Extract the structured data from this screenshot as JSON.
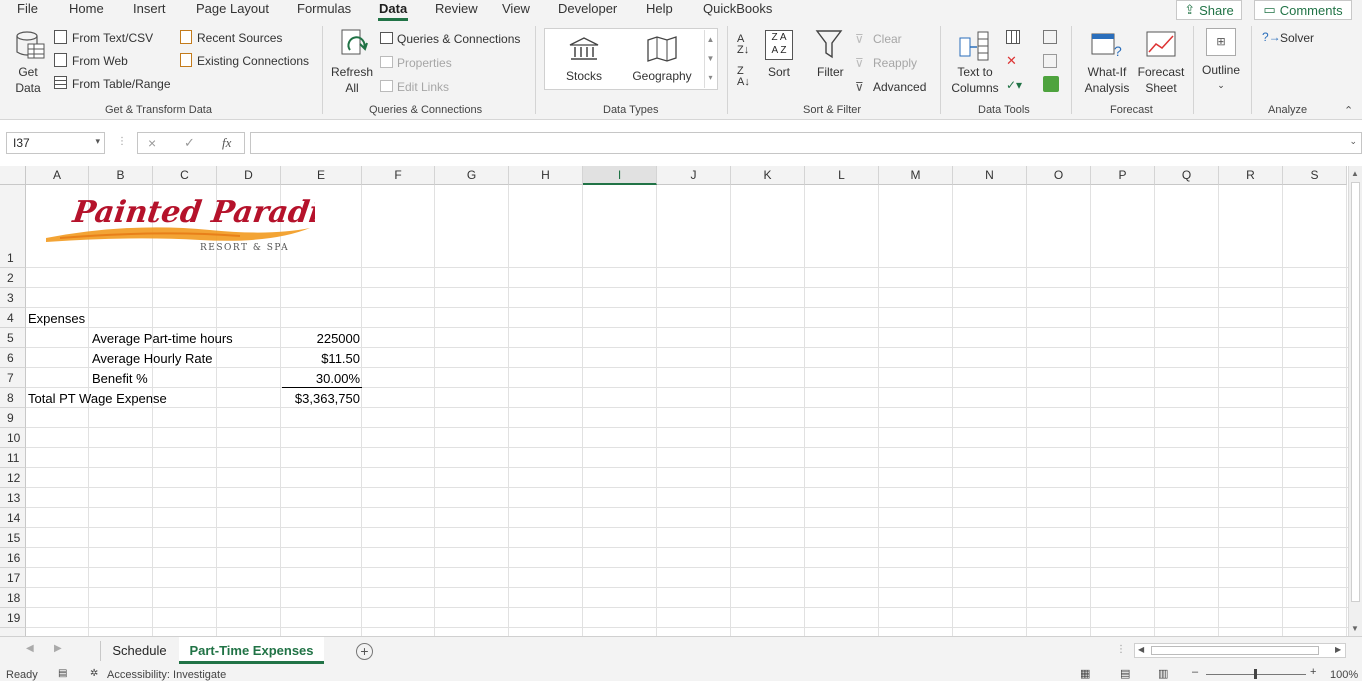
{
  "menu": {
    "tabs": [
      "File",
      "Home",
      "Insert",
      "Page Layout",
      "Formulas",
      "Data",
      "Review",
      "View",
      "Developer",
      "Help",
      "QuickBooks"
    ],
    "share": "Share",
    "comments": "Comments"
  },
  "ribbon": {
    "get_data": {
      "line1": "Get",
      "line2": "Data"
    },
    "from_text_csv": "From Text/CSV",
    "from_web": "From Web",
    "from_table_range": "From Table/Range",
    "recent_sources": "Recent Sources",
    "existing_connections": "Existing Connections",
    "group_get_transform": "Get & Transform Data",
    "refresh": {
      "line1": "Refresh",
      "line2": "All"
    },
    "queries_connections": "Queries & Connections",
    "properties": "Properties",
    "edit_links": "Edit Links",
    "group_queries": "Queries & Connections",
    "stocks": "Stocks",
    "geography": "Geography",
    "group_data_types": "Data Types",
    "sort": "Sort",
    "filter": "Filter",
    "clear": "Clear",
    "reapply": "Reapply",
    "advanced": "Advanced",
    "group_sort_filter": "Sort & Filter",
    "text_to_columns": {
      "line1": "Text to",
      "line2": "Columns"
    },
    "group_data_tools": "Data Tools",
    "what_if": {
      "line1": "What-If",
      "line2": "Analysis"
    },
    "forecast_sheet": {
      "line1": "Forecast",
      "line2": "Sheet"
    },
    "group_forecast": "Forecast",
    "outline": "Outline",
    "solver": "Solver",
    "group_analyze": "Analyze"
  },
  "formula_bar": {
    "name_box": "I37",
    "cancel": "×",
    "enter": "✓",
    "fx": "fx",
    "formula": ""
  },
  "grid": {
    "columns": [
      "A",
      "B",
      "C",
      "D",
      "E",
      "F",
      "G",
      "H",
      "I",
      "J",
      "K",
      "L",
      "M",
      "N",
      "O",
      "P",
      "Q",
      "R",
      "S"
    ],
    "rows": [
      "1",
      "2",
      "3",
      "4",
      "5",
      "6",
      "7",
      "8",
      "9",
      "10",
      "11",
      "12",
      "13",
      "14",
      "15",
      "16",
      "17",
      "18",
      "19"
    ],
    "selected_column": "I"
  },
  "logo": {
    "title": "Painted Paradise",
    "subtitle": "RESORT & SPA"
  },
  "cells": {
    "a4": "Expenses",
    "b5": "Average Part-time hours",
    "e5": "225000",
    "b6": "Average Hourly Rate",
    "e6": "$11.50",
    "b7": "Benefit %",
    "e7": "30.00%",
    "a8": "Total PT Wage Expense",
    "e8": "$3,363,750"
  },
  "sheets": [
    {
      "name": "Schedule",
      "active": false
    },
    {
      "name": "Part-Time Expenses",
      "active": true
    }
  ],
  "status": {
    "ready": "Ready",
    "accessibility": "Accessibility: Investigate",
    "zoom": "100%"
  },
  "colors": {
    "accent": "#217346",
    "logo_red": "#b5122b",
    "logo_orange": "#f29a1f"
  }
}
